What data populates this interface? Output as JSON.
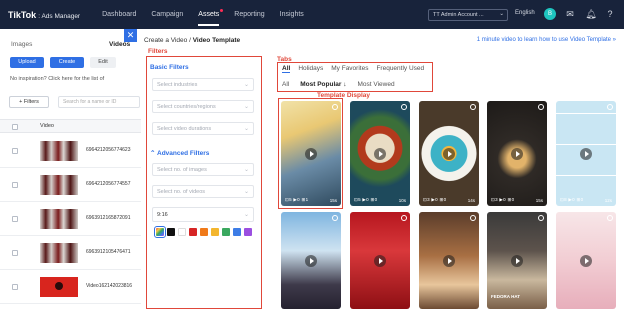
{
  "nav": {
    "brand": "TikTok",
    "brand_sub": ": Ads Manager",
    "items": [
      {
        "label": "Dashboard",
        "active": false
      },
      {
        "label": "Campaign",
        "active": false
      },
      {
        "label": "Assets",
        "active": true
      },
      {
        "label": "Reporting",
        "active": false
      },
      {
        "label": "Insights",
        "active": false
      }
    ],
    "account": "TT Admin Account ...",
    "language": "English",
    "avatar_initial": "B",
    "icons": [
      "mail-icon",
      "bell-icon",
      "help-icon"
    ]
  },
  "background": {
    "tab_images": "Images",
    "tab_videos": "Videos",
    "upload_label": "Upload",
    "create_label": "Create",
    "edit_label": "Edit",
    "notice": "No inspiration? Click here for the list of",
    "filters_label": "+ Filters",
    "search_placeholder": "Search for a name or ID",
    "video_column": "Video",
    "rows": [
      {
        "id": "6964212056774623",
        "thumb": "collage"
      },
      {
        "id": "6964212056774557",
        "thumb": "collage"
      },
      {
        "id": "6963912165872091",
        "thumb": "collage"
      },
      {
        "id": "6963912105476471",
        "thumb": "collage"
      },
      {
        "id": "Video162142023816",
        "thumb": "red"
      }
    ]
  },
  "modal": {
    "breadcrumb_parent": "Create a Video",
    "breadcrumb_sep": "/",
    "breadcrumb_current": "Video Template",
    "learn_link": "1 minute video to learn how to use Video Template »",
    "annotations": {
      "filters": "Filters",
      "tabs": "Tabs",
      "templates": "Template Display"
    },
    "filters": {
      "basic_title": "Basic Filters",
      "industries": "Select industries",
      "regions": "Select countries/regions",
      "durations": "Select video durations",
      "advanced_title": "Advanced Filters",
      "images": "Select no. of images",
      "videos": "Select no. of videos",
      "ratio": "9:16",
      "colors": [
        "multi",
        "#111111",
        "#ffffff",
        "#d62525",
        "#f07a1a",
        "#f3b62f",
        "#3aa85f",
        "#3d7de6",
        "#9b4fe0"
      ]
    },
    "tabs_primary": [
      {
        "label": "All",
        "active": true
      },
      {
        "label": "Holidays",
        "active": false
      },
      {
        "label": "My Favorites",
        "active": false
      },
      {
        "label": "Frequently Used",
        "active": false
      }
    ],
    "tabs_secondary": [
      {
        "label": "All",
        "active": false
      },
      {
        "label": "Most Popular ↓",
        "active": true
      },
      {
        "label": "Most Viewed",
        "active": false
      }
    ],
    "templates": [
      {
        "bg": "linear-gradient(160deg,#f1e2a8 0%,#e9c873 30%,#6a8ba6 60%,#2f4a5e 100%)",
        "meta": "⊡5 ▶0 ⊞1",
        "dur": "15s"
      },
      {
        "bg": "radial-gradient(circle at 50% 45%,#e9dcc4 0 22%,#b23a1d 23% 34%,#3b6f39 35% 48%,#1e4a5c 60%)",
        "meta": "⊡5 ▶0 ⊞0",
        "dur": "10s"
      },
      {
        "bg": "radial-gradient(circle at 50% 50%,#f2b63d 0 12%,#3db2c6 13% 30%,#f4f2ec 31% 45%,#4a3a2a 46%)",
        "meta": "⊡3 ▶0 ⊞0",
        "dur": "14s"
      },
      {
        "bg": "radial-gradient(circle at 50% 55%,#e2b36a 0 14%,#2f2a26 30%,#1d1a18 100%)",
        "meta": "⊡3 ▶0 ⊞0",
        "dur": "15s"
      },
      {
        "bg": "repeating-linear-gradient(0deg,#c9e6f3 0 30px,#fff 30px 31px),repeating-linear-gradient(90deg,#c9e6f3 0 19px,#fff 19px 20px)",
        "meta": "⊡8 ▶0 ⊞0",
        "dur": "12s"
      },
      {
        "bg": "linear-gradient(180deg,#7fb5e0 0%,#cfe3f1 40%,#3e3a4a 75%,#252230 100%)",
        "meta": "",
        "dur": ""
      },
      {
        "bg": "linear-gradient(180deg,#b6171f 0%,#d9383b 40%,#8e0f14 100%)",
        "meta": "",
        "dur": ""
      },
      {
        "bg": "linear-gradient(180deg,#5b3d2b 0%,#a86f43 45%,#e8c69c 75%,#6c4a32 100%)",
        "meta": "",
        "dur": ""
      },
      {
        "bg": "linear-gradient(180deg,#3a3a3a 0%,#5d534c 40%,#c9b89e 70%,#7a5f48 100%)",
        "meta": "",
        "dur": "",
        "caption": "FEDORA HAT"
      },
      {
        "bg": "linear-gradient(180deg,#f7e6e8 0%,#f2cdd3 50%,#e7aebb 100%)",
        "meta": "",
        "dur": ""
      }
    ]
  }
}
